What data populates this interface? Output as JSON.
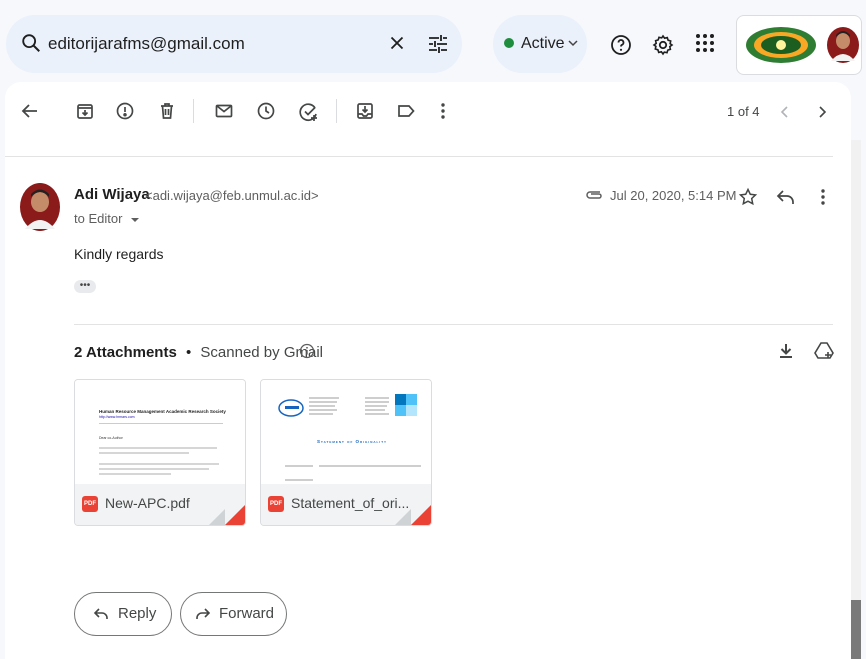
{
  "search": {
    "value": "editorijarafms@gmail.com"
  },
  "status": {
    "label": "Active"
  },
  "pager": {
    "text": "1 of 4"
  },
  "message": {
    "sender_name": "Adi Wijaya",
    "sender_email": "<adi.wijaya@feb.unmul.ac.id>",
    "to": "to Editor",
    "date": "Jul 20, 2020, 5:14 PM",
    "body": "Kindly regards",
    "more": "•••"
  },
  "attachments": {
    "count_label": "2 Attachments",
    "separator": "•",
    "scanned_label": "Scanned by Gmail",
    "files": [
      {
        "name": "New-APC.pdf",
        "type": "PDF"
      },
      {
        "name": "Statement_of_ori...",
        "type": "PDF"
      }
    ]
  },
  "preview1": {
    "title": "Human Resource Management Academic Research Society",
    "url": "http://www.hrmars.com",
    "greeting": "Dear co-Author"
  },
  "preview2": {
    "heading": "Statement of Originality"
  },
  "actions": {
    "reply": "Reply",
    "forward": "Forward"
  },
  "colors": {
    "accent": "#0b57d0",
    "active": "#1e8e3e",
    "pdf": "#ea4335"
  },
  "icons": [
    "search-icon",
    "close-icon",
    "tune-icon",
    "help-icon",
    "settings-icon",
    "apps-icon",
    "back-icon",
    "archive-icon",
    "report-icon",
    "delete-icon",
    "mark-unread-icon",
    "snooze-icon",
    "add-task-icon",
    "move-to-icon",
    "label-icon",
    "more-icon",
    "attachment-icon",
    "star-icon",
    "reply-icon",
    "download-icon",
    "drive-icon",
    "info-icon"
  ]
}
